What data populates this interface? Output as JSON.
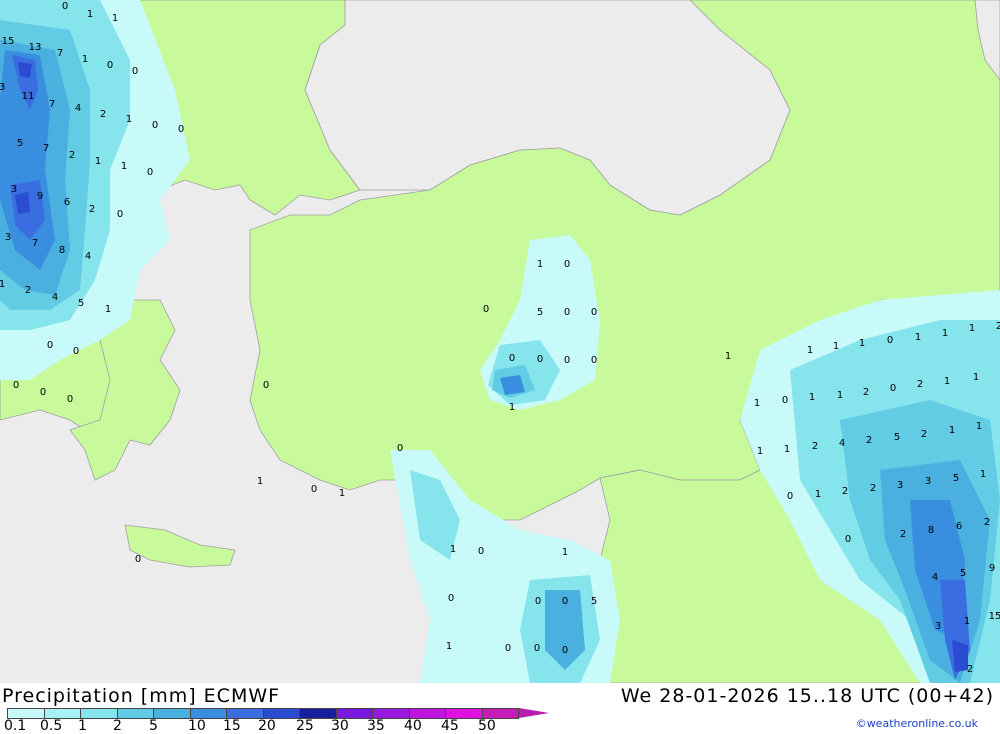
{
  "header": {
    "title": "Precipitation [mm] ECMWF",
    "valid": "We 28-01-2026 15..18 UTC (00+42)",
    "credit": "©weatheronline.co.uk"
  },
  "legend": {
    "ticks": [
      "0.1",
      "0.5",
      "1",
      "2",
      "5",
      "10",
      "15",
      "20",
      "25",
      "30",
      "35",
      "40",
      "45",
      "50"
    ],
    "colors": [
      "#c8fafa",
      "#a6f2f2",
      "#86e4ec",
      "#62cce4",
      "#4ab0e0",
      "#3a8ee0",
      "#3a6ee0",
      "#2a4cd0",
      "#14209c",
      "#7a18e0",
      "#9818e0",
      "#c014e0",
      "#e010e0",
      "#c81cb8"
    ]
  },
  "map": {
    "colors": {
      "land": "#c8fa9c",
      "sea": "#ececec",
      "border": "#a0a0a0"
    },
    "labels": [
      "0",
      "1",
      "1",
      "15",
      "13",
      "7",
      "1",
      "0",
      "0",
      "3",
      "11",
      "7",
      "4",
      "2",
      "1",
      "0",
      "0",
      "5",
      "7",
      "2",
      "1",
      "1",
      "0",
      "3",
      "9",
      "6",
      "2",
      "0",
      "3",
      "7",
      "8",
      "4",
      "1",
      "2",
      "4",
      "5",
      "1",
      "0",
      "0",
      "0",
      "0",
      "0",
      "0",
      "1",
      "0",
      "1",
      "0",
      "0",
      "1",
      "0",
      "0",
      "5",
      "0",
      "0",
      "0",
      "0",
      "0",
      "0",
      "1",
      "1",
      "1",
      "1",
      "1",
      "0",
      "1",
      "1",
      "1",
      "2",
      "1",
      "0",
      "1",
      "1",
      "2",
      "0",
      "2",
      "1",
      "1",
      "1",
      "1",
      "2",
      "4",
      "2",
      "5",
      "2",
      "1",
      "1",
      "0",
      "1",
      "2",
      "2",
      "3",
      "3",
      "5",
      "1",
      "0",
      "2",
      "8",
      "6",
      "2",
      "1",
      "0",
      "1",
      "0",
      "0",
      "0",
      "5",
      "1",
      "0",
      "0",
      "0",
      "4",
      "5",
      "9",
      "3",
      "1",
      "15",
      "2",
      "5"
    ]
  }
}
